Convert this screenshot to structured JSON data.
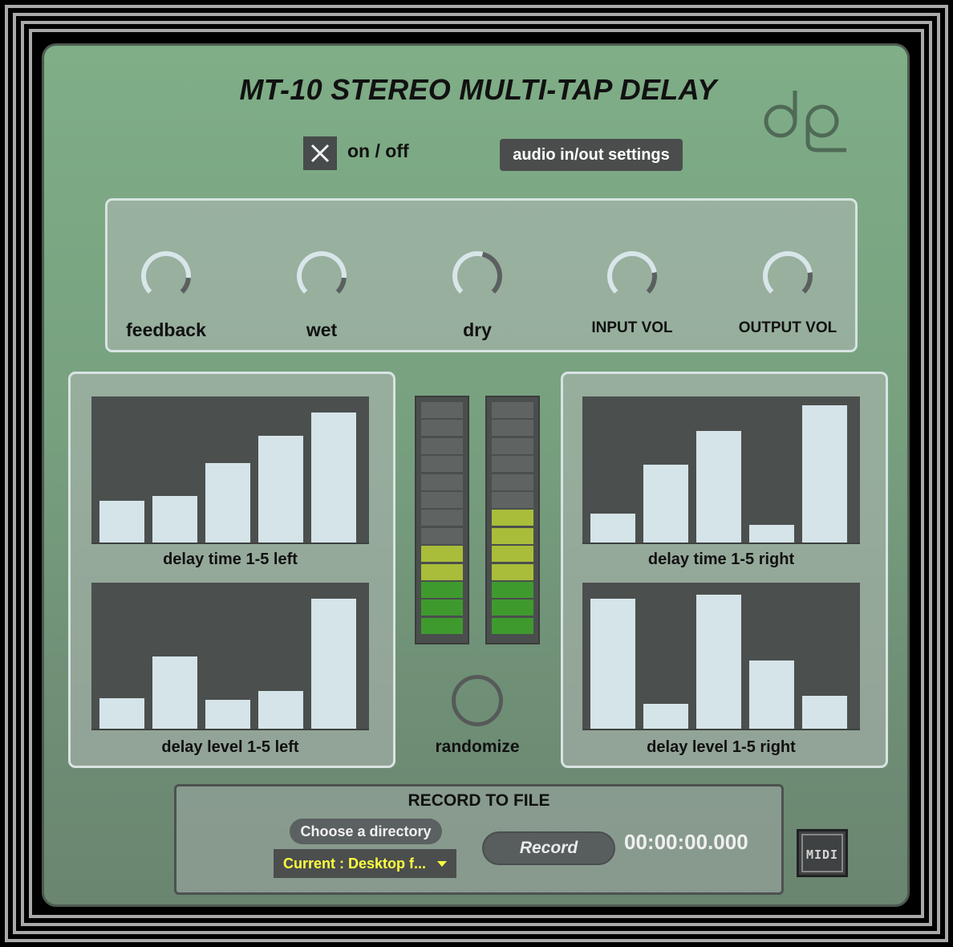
{
  "app": {
    "title": "MT-10 STEREO MULTI-TAP DELAY"
  },
  "header": {
    "power_icon": "close-x-icon",
    "power_label": "on / off",
    "audio_settings_label": "audio in/out settings",
    "logo": "dp-logo"
  },
  "knobs": [
    {
      "label": "feedback",
      "level": 0.85
    },
    {
      "label": "wet",
      "level": 0.85
    },
    {
      "label": "dry",
      "level": 0.55
    },
    {
      "label": "INPUT VOL",
      "level": 0.8
    },
    {
      "label": "OUTPUT VOL",
      "level": 0.8
    }
  ],
  "graphs": {
    "delay_time_left": {
      "label": "delay time 1-5 left",
      "values": [
        0.29,
        0.32,
        0.55,
        0.74,
        0.9
      ]
    },
    "delay_level_left": {
      "label": "delay level 1-5 left",
      "values": [
        0.21,
        0.5,
        0.2,
        0.26,
        0.9
      ]
    },
    "delay_time_right": {
      "label": "delay time 1-5 right",
      "values": [
        0.2,
        0.54,
        0.77,
        0.12,
        0.95
      ]
    },
    "delay_level_right": {
      "label": "delay level 1-5 right",
      "values": [
        0.9,
        0.17,
        0.93,
        0.47,
        0.23
      ]
    }
  },
  "meters": {
    "left_level": 0.42,
    "right_level": 0.54,
    "colors": {
      "off": "#5f6463",
      "green": "#3f9a2e",
      "yellow": "#a9bd3a"
    }
  },
  "randomize": {
    "label": "randomize"
  },
  "record": {
    "title": "RECORD TO FILE",
    "choose_label": "Choose a directory",
    "current_label": "Current : Desktop f...",
    "record_label": "Record",
    "time": "00:00:00.000"
  },
  "midi": {
    "label": "MIDI"
  }
}
